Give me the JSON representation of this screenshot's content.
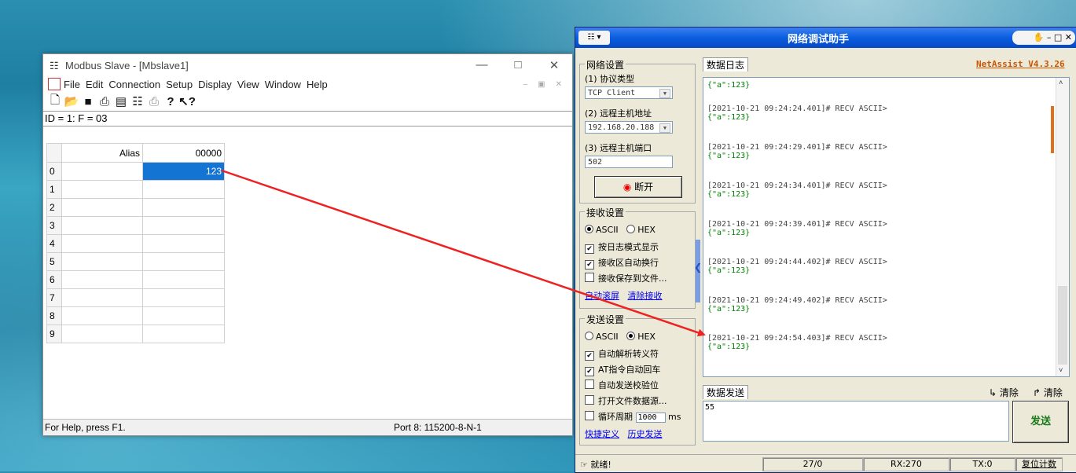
{
  "modbus": {
    "title": "Modbus Slave - [Mbslave1]",
    "menu": [
      "File",
      "Edit",
      "Connection",
      "Setup",
      "Display",
      "View",
      "Window",
      "Help"
    ],
    "id_line": "ID = 1: F = 03",
    "grid": {
      "headers": [
        "Alias",
        "00000"
      ],
      "rows": [
        "0",
        "1",
        "2",
        "3",
        "4",
        "5",
        "6",
        "7",
        "8",
        "9"
      ],
      "value_0": "123"
    },
    "status_help": "For Help, press F1.",
    "status_port": "Port 8: 115200-8-N-1"
  },
  "netassist": {
    "title": "网络调试助手",
    "version": "NetAssist V4.3.26",
    "net_settings": {
      "label": "网络设置",
      "protocol_label": "(1) 协议类型",
      "protocol_value": "TCP Client",
      "host_label": "(2) 远程主机地址",
      "host_value": "192.168.20.188",
      "port_label": "(3) 远程主机端口",
      "port_value": "502",
      "disconnect": "断开"
    },
    "recv_settings": {
      "label": "接收设置",
      "ascii": "ASCII",
      "hex": "HEX",
      "opt1": "按日志模式显示",
      "opt2": "接收区自动换行",
      "opt3": "接收保存到文件...",
      "link1": "自动滚屏",
      "link2": "清除接收"
    },
    "send_settings": {
      "label": "发送设置",
      "ascii": "ASCII",
      "hex": "HEX",
      "opt1": "自动解析转义符",
      "opt2": "AT指令自动回车",
      "opt3": "自动发送校验位",
      "opt4": "打开文件数据源...",
      "opt5": "循环周期",
      "period": "1000",
      "unit": "ms",
      "link1": "快捷定义",
      "link2": "历史发送"
    },
    "log_tab": "数据日志",
    "log_top": "{\"a\":123}",
    "log": [
      {
        "head": "[2021-10-21 09:24:24.401]# RECV ASCII>",
        "body": "{\"a\":123}"
      },
      {
        "head": "[2021-10-21 09:24:29.401]# RECV ASCII>",
        "body": "{\"a\":123}"
      },
      {
        "head": "[2021-10-21 09:24:34.401]# RECV ASCII>",
        "body": "{\"a\":123}"
      },
      {
        "head": "[2021-10-21 09:24:39.401]# RECV ASCII>",
        "body": "{\"a\":123}"
      },
      {
        "head": "[2021-10-21 09:24:44.402]# RECV ASCII>",
        "body": "{\"a\":123}"
      },
      {
        "head": "[2021-10-21 09:24:49.402]# RECV ASCII>",
        "body": "{\"a\":123}"
      },
      {
        "head": "[2021-10-21 09:24:54.403]# RECV ASCII>",
        "body": "{\"a\":123}"
      }
    ],
    "send_tab": "数据发送",
    "clear1": "清除",
    "clear2": "清除",
    "send_value": "55",
    "send_button": "发送",
    "status_ready": "就绪!",
    "status_count": "27/0",
    "status_rx": "RX:270",
    "status_tx": "TX:0",
    "status_reset": "复位计数"
  }
}
